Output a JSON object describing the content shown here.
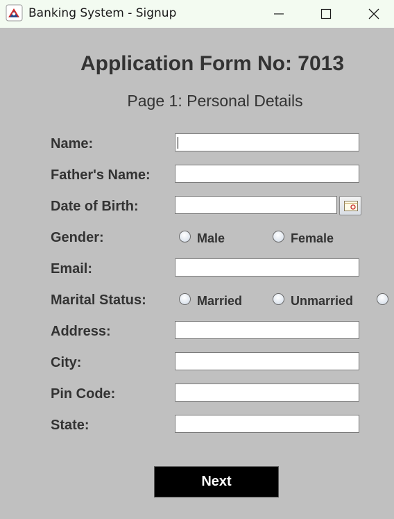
{
  "window": {
    "title": "Banking System - Signup",
    "icons": [
      "java-app-icon",
      "minimize-icon",
      "maximize-icon",
      "close-icon"
    ]
  },
  "form": {
    "heading": "Application Form No: 7013",
    "subheading": "Page 1: Personal Details",
    "labels": {
      "name": "Name:",
      "father_name": "Father's Name:",
      "dob": "Date of Birth:",
      "gender": "Gender:",
      "email": "Email:",
      "marital_status": "Marital Status:",
      "address": "Address:",
      "city": "City:",
      "pin_code": "Pin Code:",
      "state": "State:"
    },
    "values": {
      "name": "",
      "father_name": "",
      "dob": "",
      "email": "",
      "address": "",
      "city": "",
      "pin_code": "",
      "state": ""
    },
    "gender_options": [
      "Male",
      "Female"
    ],
    "marital_options": [
      "Married",
      "Unmarried"
    ],
    "next_label": "Next"
  }
}
